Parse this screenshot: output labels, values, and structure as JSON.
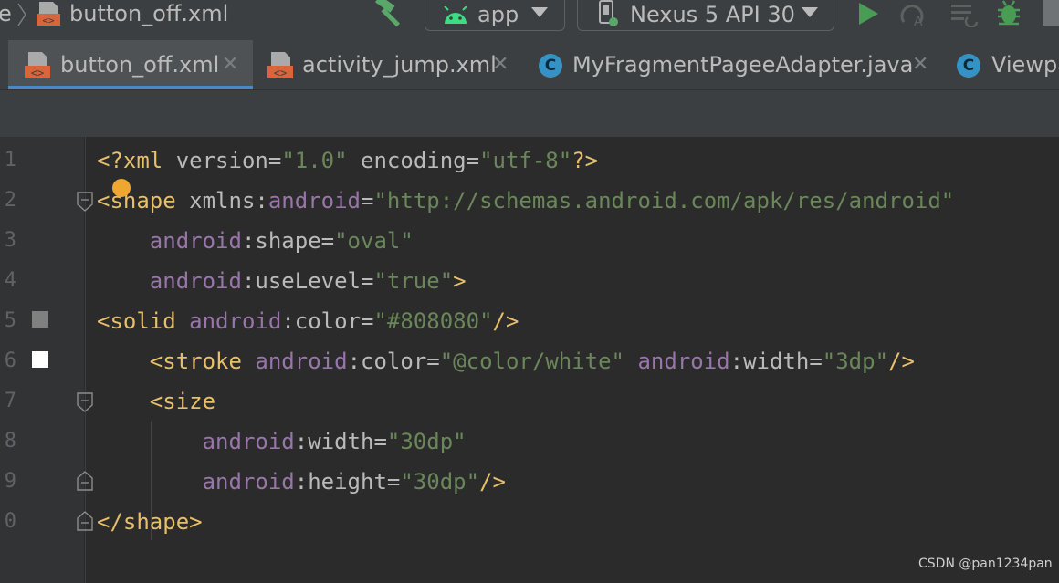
{
  "toolbar": {
    "breadcrumb_prefix": "e",
    "breadcrumb_file": "button_off.xml",
    "build_icon": "hammer-icon",
    "run_config": "app",
    "device": "Nexus 5 API 30",
    "run_icon": "run-icon",
    "apply_changes_icon": "apply-changes-icon",
    "sync_icon": "sync-icon",
    "debug_icon": "debug-icon"
  },
  "tabs": [
    {
      "label": "button_off.xml",
      "icon": "xml-file-icon",
      "active": true
    },
    {
      "label": "activity_jump.xml",
      "icon": "xml-file-icon",
      "active": false
    },
    {
      "label": "MyFragmentPageeAdapter.java",
      "icon": "class-icon",
      "active": false
    },
    {
      "label": "Viewpa",
      "icon": "class-icon",
      "active": false
    }
  ],
  "class_icon_letter": "C",
  "editor": {
    "line_numbers": [
      "1",
      "2",
      "3",
      "4",
      "5",
      "6",
      "7",
      "8",
      "9",
      "0"
    ],
    "lines": {
      "l1": {
        "open": "<?xml",
        "a1": "version",
        "eq1": "=",
        "v1": "\"1.0\"",
        "a2": "encoding",
        "eq2": "=",
        "v2": "\"utf-8\"",
        "close": "?>"
      },
      "l2": {
        "open": "<shape",
        "a1": "xmlns",
        "colon": ":",
        "ns": "android",
        "eq": "=",
        "v": "\"http://schemas.android.com/apk/res/android\""
      },
      "l3": {
        "ns": "android",
        "colon": ":",
        "a": "shape",
        "eq": "=",
        "v": "\"oval\""
      },
      "l4": {
        "ns": "android",
        "colon": ":",
        "a": "useLevel",
        "eq": "=",
        "v": "\"true\"",
        "close": ">"
      },
      "l5": {
        "open": "<solid",
        "ns": "android",
        "colon": ":",
        "a": "color",
        "eq": "=",
        "v": "\"#808080\"",
        "close": "/>"
      },
      "l6": {
        "open": "<stroke",
        "ns1": "android",
        "colon1": ":",
        "a1": "color",
        "eq1": "=",
        "v1": "\"@color/white\"",
        "ns2": "android",
        "colon2": ":",
        "a2": "width",
        "eq2": "=",
        "v2": "\"3dp\"",
        "close": "/>"
      },
      "l7": {
        "open": "<size"
      },
      "l8": {
        "ns": "android",
        "colon": ":",
        "a": "width",
        "eq": "=",
        "v": "\"30dp\""
      },
      "l9": {
        "ns": "android",
        "colon": ":",
        "a": "height",
        "eq": "=",
        "v": "\"30dp\"",
        "close": "/>"
      },
      "l10": {
        "close": "</shape>"
      }
    },
    "swatch_colors": {
      "solid": "#808080",
      "stroke": "#ffffff"
    }
  },
  "watermark": "CSDN @pan1234pan"
}
